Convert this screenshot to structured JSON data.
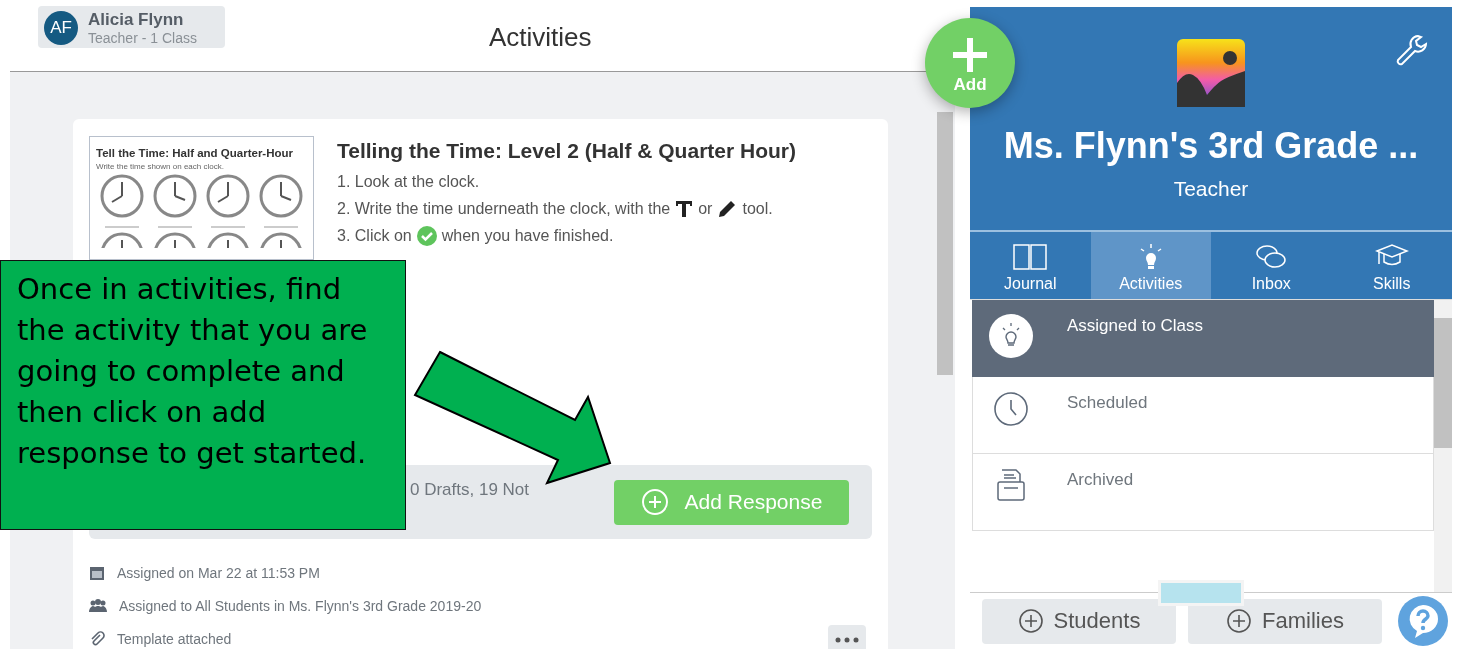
{
  "user": {
    "initials": "AF",
    "name": "Alicia Flynn",
    "role": "Teacher - 1 Class"
  },
  "page_title": "Activities",
  "activity": {
    "thumbnail": {
      "title": "Tell the Time: Half and Quarter-Hour",
      "instruction": "Write the time shown on each clock."
    },
    "title": "Telling the Time: Level 2 (Half & Quarter Hour)",
    "steps": [
      [
        {
          "text": "1. Look at the clock."
        }
      ],
      [
        {
          "text": "2. Write the time underneath the clock, with the"
        },
        {
          "kind": "text-tool"
        },
        {
          "text": "or"
        },
        {
          "kind": "pencil"
        },
        {
          "text": "tool."
        }
      ],
      [
        {
          "text": "3. Click on"
        },
        {
          "kind": "check"
        },
        {
          "text": "when you have finished."
        }
      ]
    ],
    "status": "0 Drafts, 19 Not",
    "response_button": "Add Response",
    "meta": [
      {
        "kind": "calendar",
        "text": "Assigned on Mar 22 at 11:53 PM"
      },
      {
        "kind": "people",
        "text": "Assigned to All Students in Ms. Flynn's 3rd Grade 2019-20"
      },
      {
        "kind": "clip",
        "text": "Template attached"
      }
    ]
  },
  "add_button": "Add",
  "class_panel": {
    "name": "Ms. Flynn's 3rd Grade ...",
    "role": "Teacher",
    "tabs": [
      {
        "label": "Journal",
        "selected": false
      },
      {
        "label": "Activities",
        "selected": true
      },
      {
        "label": "Inbox",
        "selected": false
      },
      {
        "label": "Skills",
        "selected": false
      }
    ],
    "folders": [
      {
        "label": "Assigned to Class",
        "selected": true
      },
      {
        "label": "Scheduled",
        "selected": false
      },
      {
        "label": "Archived",
        "selected": false
      }
    ],
    "buttons": [
      "Students",
      "Families"
    ]
  },
  "callout": {
    "text": "Once in activities, find the activity that you are going to complete and then click on add response to get started."
  }
}
